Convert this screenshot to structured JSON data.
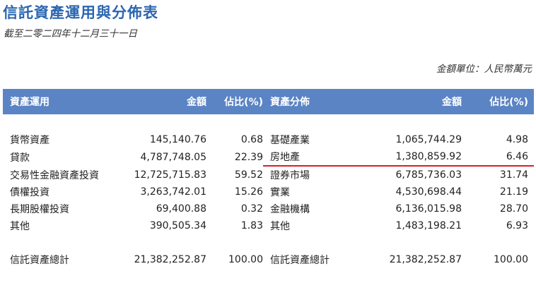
{
  "title": "信託資產運用與分佈表",
  "subtitle": "截至二零二四年十二月三十一日",
  "unit": "金額單位：人民幣萬元",
  "table": {
    "headers": [
      "資產運用",
      "金額",
      "佔比(%)",
      "資產分佈",
      "金額",
      "佔比(%)"
    ],
    "rows": [
      [
        "貨幣資產",
        "145,140.76",
        "0.68",
        "基礎產業",
        "1,065,744.29",
        "4.98"
      ],
      [
        "貸款",
        "4,787,748.05",
        "22.39",
        "房地產",
        "1,380,859.92",
        "6.46"
      ],
      [
        "交易性金融資產投資",
        "12,725,715.83",
        "59.52",
        "證券市場",
        "6,785,736.03",
        "31.74"
      ],
      [
        "債權投資",
        "3,263,742.01",
        "15.26",
        "實業",
        "4,530,698.44",
        "21.19"
      ],
      [
        "長期股權投資",
        "69,400.88",
        "0.32",
        "金融機構",
        "6,136,015.98",
        "28.70"
      ],
      [
        "其他",
        "390,505.34",
        "1.83",
        "其他",
        "1,483,198.21",
        "6.93"
      ]
    ],
    "total": [
      "信託資產總計",
      "21,382,252.87",
      "100.00",
      "信託資產總計",
      "21,382,252.87",
      "100.00"
    ]
  },
  "highlight_color": "#d81e2a",
  "header_color": "#5b84c4",
  "title_color": "#2b66b1"
}
